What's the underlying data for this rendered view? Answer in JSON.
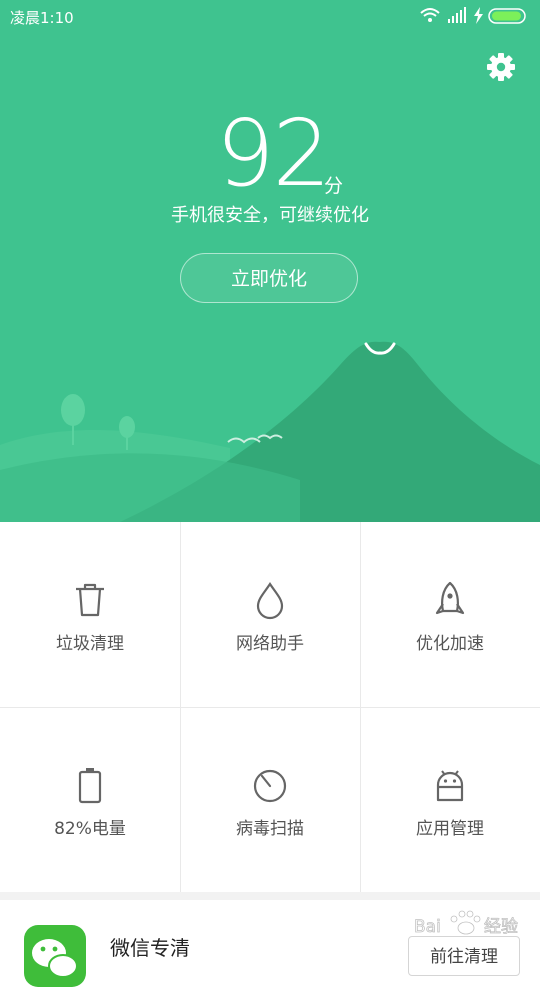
{
  "status_bar": {
    "time": "凌晨1:10"
  },
  "hero": {
    "score": "92",
    "score_unit": "分",
    "tagline": "手机很安全，可继续优化",
    "optimize_button": "立即优化"
  },
  "tools": [
    {
      "label": "垃圾清理",
      "icon": "trash-icon"
    },
    {
      "label": "网络助手",
      "icon": "drop-icon"
    },
    {
      "label": "优化加速",
      "icon": "rocket-icon"
    },
    {
      "label": "82%电量",
      "icon": "battery-icon"
    },
    {
      "label": "病毒扫描",
      "icon": "scan-icon"
    },
    {
      "label": "应用管理",
      "icon": "android-icon"
    }
  ],
  "card": {
    "title": "微信专清",
    "button": "前往清理"
  },
  "watermark": "Bai度 经验",
  "colors": {
    "primary": "#3fc38f",
    "hill": "#36ae7c",
    "wechat": "#3fbd3a"
  }
}
